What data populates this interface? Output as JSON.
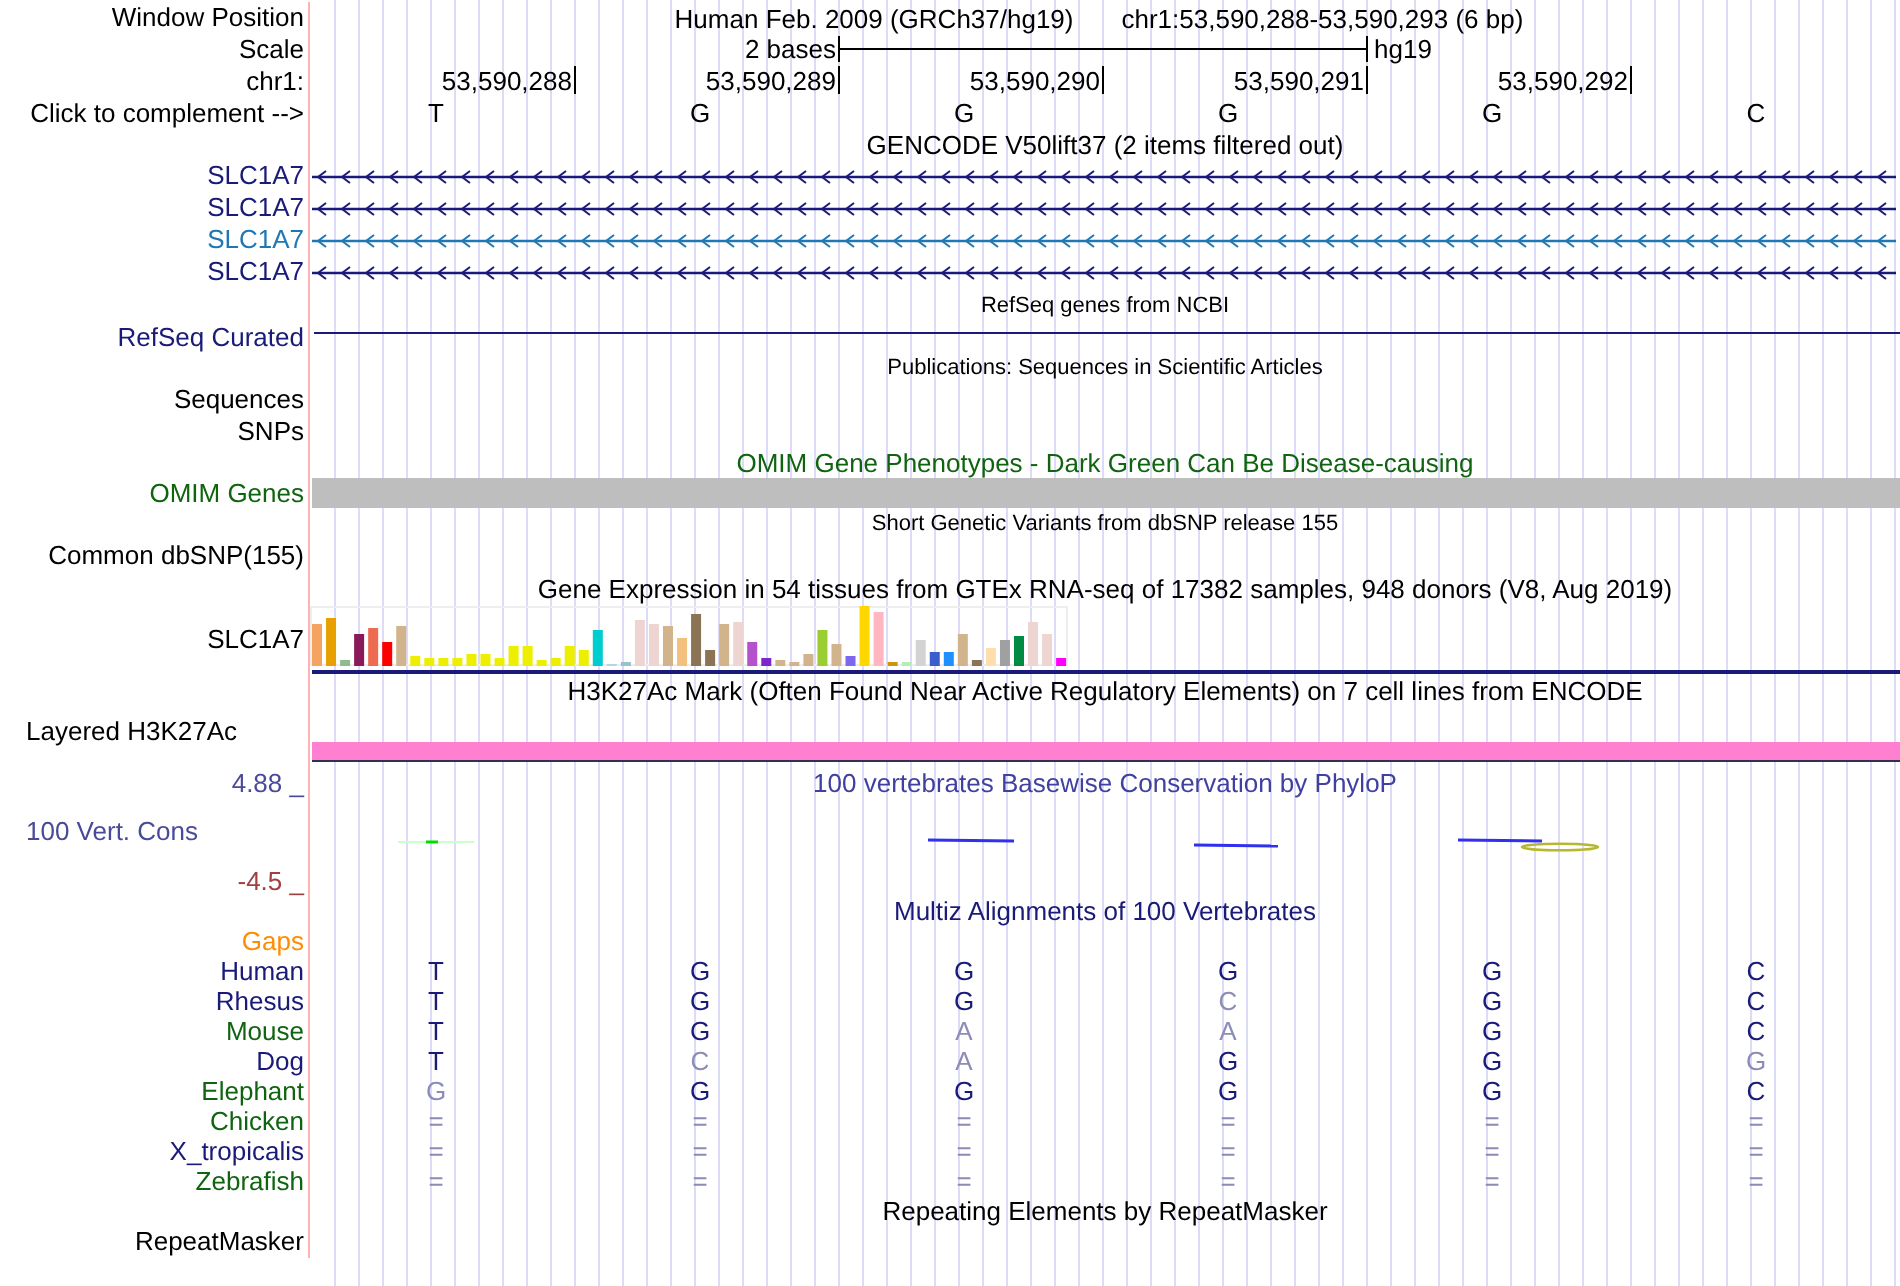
{
  "header": {
    "label": "Window Position",
    "assembly": "Human Feb. 2009 (GRCh37/hg19)",
    "region": "chr1:53,590,288-53,590,293 (6 bp)"
  },
  "scale": {
    "label": "Scale",
    "length": "2 bases",
    "assembly": "hg19"
  },
  "ruler": {
    "label": "chr1:",
    "positions": [
      "53,590,288",
      "53,590,289",
      "53,590,290",
      "53,590,291",
      "53,590,292"
    ]
  },
  "complement": {
    "label": "Click to complement -->",
    "bases": [
      "T",
      "G",
      "G",
      "G",
      "G",
      "C"
    ]
  },
  "tracks": [
    {
      "kind": "transcripts",
      "title": "GENCODE V50lift37 (2 items filtered out)",
      "items": [
        {
          "label": "SLC1A7",
          "color": "#1a1a78"
        },
        {
          "label": "SLC1A7",
          "color": "#1a1a78"
        },
        {
          "label": "SLC1A7",
          "color": "#1f78b4"
        },
        {
          "label": "SLC1A7",
          "color": "#1a1a78"
        }
      ]
    },
    {
      "kind": "refseq",
      "title": "RefSeq genes from NCBI",
      "labels": [
        "RefSeq Curated"
      ]
    },
    {
      "kind": "annotation",
      "title": "Publications: Sequences in Scientific Articles",
      "labels": [
        "Sequences",
        "SNPs"
      ]
    },
    {
      "kind": "omim",
      "title": "OMIM Gene Phenotypes - Dark Green Can Be Disease-causing",
      "labels": [
        "OMIM Genes"
      ]
    },
    {
      "kind": "annotation",
      "title": "Short Genetic Variants from dbSNP release 155",
      "labels": [
        "Common dbSNP(155)"
      ]
    },
    {
      "kind": "expression",
      "title": "Gene Expression in 54 tissues from GTEx RNA-seq of 17382 samples, 948 donors (V8, Aug 2019)",
      "labels": [
        "SLC1A7"
      ]
    },
    {
      "kind": "h3k27ac",
      "title": "H3K27Ac Mark (Often Found Near Active Regulatory Elements) on 7 cell lines from ENCODE",
      "labels": [
        "Layered H3K27Ac"
      ]
    },
    {
      "kind": "conservation",
      "title": "100 vertebrates Basewise Conservation by PhyloP",
      "labels": [
        "100 Vert. Cons"
      ],
      "max": "4.88 _",
      "min": "-4.5 _"
    },
    {
      "kind": "multiz",
      "title": "Multiz Alignments of 100 Vertebrates",
      "gaps_label": "Gaps",
      "species": [
        {
          "name": "Human",
          "color": "#1a1a78",
          "bases": [
            {
              "text": "T",
              "match": true
            },
            {
              "text": "G",
              "match": true
            },
            {
              "text": "G",
              "match": true
            },
            {
              "text": "G",
              "match": true
            },
            {
              "text": "G",
              "match": true
            },
            {
              "text": "C",
              "match": true
            }
          ]
        },
        {
          "name": "Rhesus",
          "color": "#1a1a78",
          "bases": [
            {
              "text": "T",
              "match": true
            },
            {
              "text": "G",
              "match": true
            },
            {
              "text": "G",
              "match": true
            },
            {
              "text": "C",
              "match": false
            },
            {
              "text": "G",
              "match": true
            },
            {
              "text": "C",
              "match": true
            }
          ]
        },
        {
          "name": "Mouse",
          "color": "#106410",
          "bases": [
            {
              "text": "T",
              "match": true
            },
            {
              "text": "G",
              "match": true
            },
            {
              "text": "A",
              "match": false
            },
            {
              "text": "A",
              "match": false
            },
            {
              "text": "G",
              "match": true
            },
            {
              "text": "C",
              "match": true
            }
          ]
        },
        {
          "name": "Dog",
          "color": "#1a1a78",
          "bases": [
            {
              "text": "T",
              "match": true
            },
            {
              "text": "C",
              "match": false
            },
            {
              "text": "A",
              "match": false
            },
            {
              "text": "G",
              "match": true
            },
            {
              "text": "G",
              "match": true
            },
            {
              "text": "G",
              "match": false
            }
          ]
        },
        {
          "name": "Elephant",
          "color": "#106410",
          "bases": [
            {
              "text": "G",
              "match": false
            },
            {
              "text": "G",
              "match": true
            },
            {
              "text": "G",
              "match": true
            },
            {
              "text": "G",
              "match": true
            },
            {
              "text": "G",
              "match": true
            },
            {
              "text": "C",
              "match": true
            }
          ]
        },
        {
          "name": "Chicken",
          "color": "#106410",
          "bases": [
            {
              "text": "=",
              "match": false
            },
            {
              "text": "=",
              "match": false
            },
            {
              "text": "=",
              "match": false
            },
            {
              "text": "=",
              "match": false
            },
            {
              "text": "=",
              "match": false
            },
            {
              "text": "=",
              "match": false
            }
          ]
        },
        {
          "name": "X_tropicalis",
          "color": "#1a1a78",
          "bases": [
            {
              "text": "=",
              "match": false
            },
            {
              "text": "=",
              "match": false
            },
            {
              "text": "=",
              "match": false
            },
            {
              "text": "=",
              "match": false
            },
            {
              "text": "=",
              "match": false
            },
            {
              "text": "=",
              "match": false
            }
          ]
        },
        {
          "name": "Zebrafish",
          "color": "#106410",
          "bases": [
            {
              "text": "=",
              "match": false
            },
            {
              "text": "=",
              "match": false
            },
            {
              "text": "=",
              "match": false
            },
            {
              "text": "=",
              "match": false
            },
            {
              "text": "=",
              "match": false
            },
            {
              "text": "=",
              "match": false
            }
          ]
        }
      ]
    },
    {
      "kind": "repeats",
      "title": "Repeating Elements by RepeatMasker",
      "labels": [
        "RepeatMasker"
      ]
    }
  ]
}
